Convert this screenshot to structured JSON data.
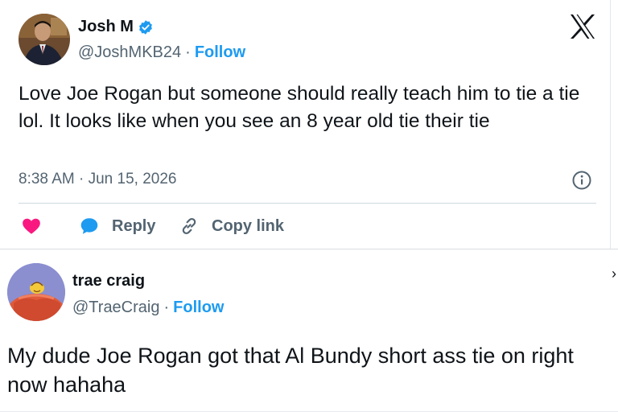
{
  "tweet1": {
    "author": {
      "display_name": "Josh M",
      "handle": "@JoshMKB24",
      "verified": true,
      "follow_label": "Follow",
      "separator": "·"
    },
    "text": "Love Joe Rogan but someone should really teach him to tie a tie lol. It looks like when you see an 8 year old tie their tie",
    "timestamp": "8:38 AM · Jun 15, 2026",
    "actions": {
      "like_icon": "heart-icon",
      "reply_label": "Reply",
      "copy_link_label": "Copy link"
    },
    "icons": [
      "x-logo-icon",
      "verified-badge-icon",
      "info-icon",
      "heart-icon",
      "reply-bubble-icon",
      "link-icon"
    ]
  },
  "tweet2": {
    "author": {
      "display_name": "trae craig",
      "handle": "@TraeCraig",
      "follow_label": "Follow",
      "separator": "·"
    },
    "text": "My dude Joe Rogan got that Al Bundy short ass tie on right now hahaha"
  },
  "colors": {
    "accent": "#1d9bf0",
    "text": "#0f1419",
    "muted": "#536471",
    "like": "#f91880",
    "divider": "#cfd9de"
  }
}
